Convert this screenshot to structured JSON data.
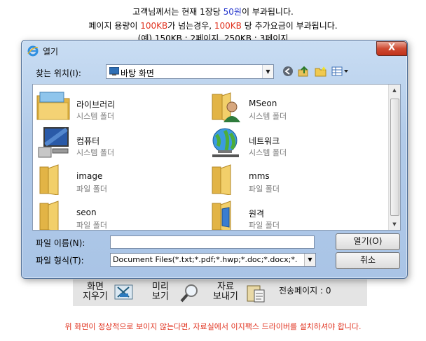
{
  "notice": {
    "line1": {
      "pre": "고객님께서는 현재 1장당 ",
      "price": "50원",
      "post": "이 부과됩니다."
    },
    "line2": {
      "pre": "페이지 용량이 ",
      "size1": "100KB",
      "mid": "가 넘는경우, ",
      "size2": "100KB",
      "post": " 당 추가요금이 부과됩니다."
    },
    "line3": "(예) 150KB : 2페이지, 250KB : 3페이지"
  },
  "dialog": {
    "title": "열기",
    "close_label": "X",
    "look_in_label": "찾는 위치(I):",
    "look_in_value": "바탕 화면",
    "items": [
      {
        "name": "라이브러리",
        "type": "시스템 폴더",
        "icon": "library-icon"
      },
      {
        "name": "MSeon",
        "type": "시스템 폴더",
        "icon": "user-folder-icon"
      },
      {
        "name": "컴퓨터",
        "type": "시스템 폴더",
        "icon": "computer-icon"
      },
      {
        "name": "네트워크",
        "type": "시스템 폴더",
        "icon": "network-icon"
      },
      {
        "name": "image",
        "type": "파일 폴더",
        "icon": "folder-icon"
      },
      {
        "name": "mms",
        "type": "파일 폴더",
        "icon": "folder-icon"
      },
      {
        "name": "seon",
        "type": "파일 폴더",
        "icon": "folder-icon"
      },
      {
        "name": "원격",
        "type": "파일 폴더",
        "icon": "remote-folder-icon"
      }
    ],
    "file_name_label": "파일 이름(N):",
    "file_name_value": "",
    "file_type_label": "파일 형식(T):",
    "file_type_value": "Document Files(*.txt;*.pdf;*.hwp;*.doc;*.docx;*.",
    "open_button": "열기(O)",
    "cancel_button": "취소"
  },
  "toolbar": {
    "clear_label1": "화면",
    "clear_label2": "지우기",
    "preview_label1": "미리",
    "preview_label2": "보기",
    "send_label1": "자료",
    "send_label2": "보내기",
    "sent_pages": "전송페이지 : 0"
  },
  "footer": "위 화면이 정상적으로 보이지 않는다면, 자료실에서 이지팩스 드라이버를 설치하셔야 합니다."
}
